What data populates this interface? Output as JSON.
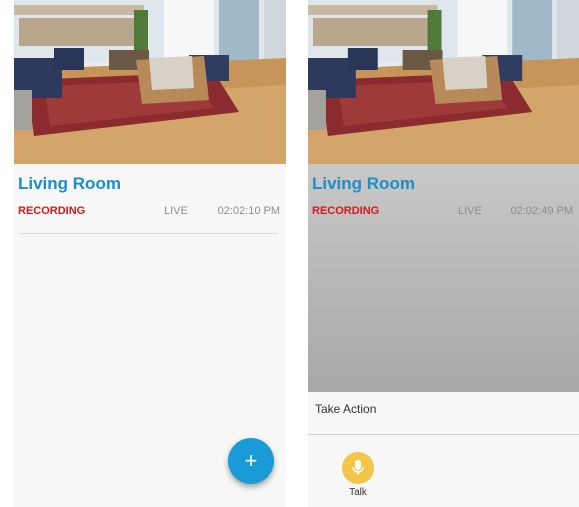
{
  "screens": [
    {
      "camera_name": "Living Room",
      "recording_label": "RECORDING",
      "live_label": "LIVE",
      "time": "02:02:10 PM",
      "fab_label": "+"
    },
    {
      "camera_name": "Living Room",
      "recording_label": "RECORDING",
      "live_label": "LIVE",
      "time": "02:02:49 PM",
      "action_sheet": {
        "title": "Take Action",
        "actions": [
          {
            "label": "Talk",
            "icon": "microphone-icon"
          }
        ]
      }
    }
  ],
  "colors": {
    "title": "#1a8fc9",
    "recording": "#d11a1a",
    "fab": "#1a9ad6",
    "talk": "#f3c64a"
  }
}
